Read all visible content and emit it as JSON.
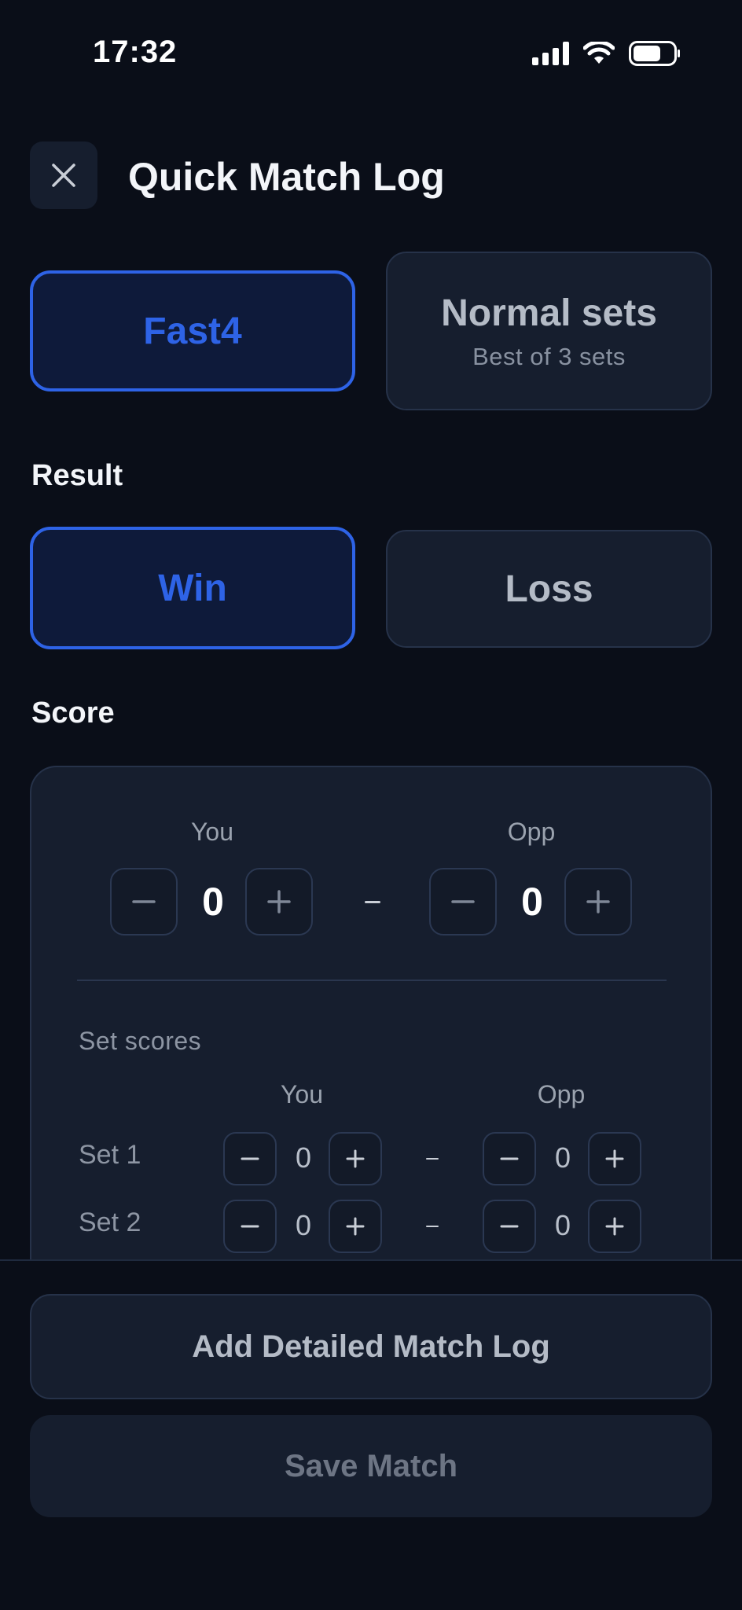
{
  "status_bar": {
    "time": "17:32"
  },
  "header": {
    "title": "Quick Match Log",
    "close_icon": "close-icon"
  },
  "format": {
    "options": [
      {
        "label": "Fast4",
        "sub": "",
        "selected": true
      },
      {
        "label": "Normal sets",
        "sub": "Best of 3 sets",
        "selected": false
      }
    ]
  },
  "result": {
    "label": "Result",
    "options": [
      {
        "label": "Win",
        "selected": true
      },
      {
        "label": "Loss",
        "selected": false
      }
    ]
  },
  "score": {
    "label": "Score",
    "you_label": "You",
    "opp_label": "Opp",
    "you_value": "0",
    "opp_value": "0",
    "set_scores_label": "Set scores",
    "set_you_label": "You",
    "set_opp_label": "Opp",
    "sets": [
      {
        "label": "Set 1",
        "you": "0",
        "opp": "0"
      },
      {
        "label": "Set 2",
        "you": "0",
        "opp": "0"
      }
    ]
  },
  "actions": {
    "detailed_label": "Add Detailed Match Log",
    "save_label": "Save Match"
  },
  "colors": {
    "background": "#0a0e18",
    "card": "#161e2e",
    "accent": "#2e63e6"
  }
}
